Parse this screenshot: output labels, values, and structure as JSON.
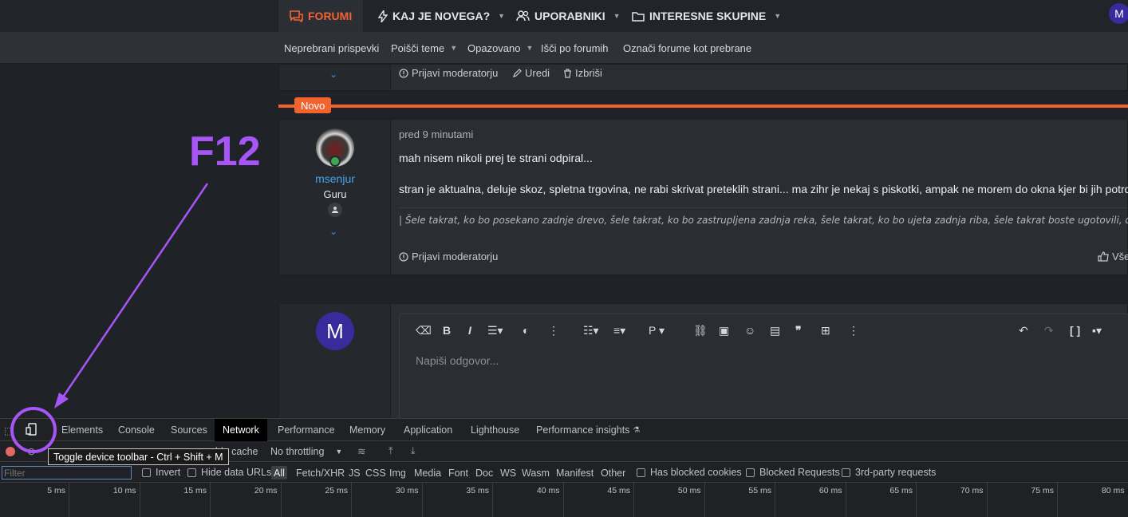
{
  "nav": {
    "items": [
      {
        "label": "FORUMI",
        "icon": "forum-icon"
      },
      {
        "label": "KAJ JE NOVEGA?",
        "icon": "bolt-icon"
      },
      {
        "label": "UPORABNIKI",
        "icon": "users-icon"
      },
      {
        "label": "INTERESNE SKUPINE",
        "icon": "folder-icon"
      }
    ],
    "avatar_letter": "M"
  },
  "subnav": {
    "items": [
      {
        "label": "Neprebrani prispevki"
      },
      {
        "label": "Poišči teme"
      },
      {
        "label": "Opazovano"
      },
      {
        "label": "Išči po forumih"
      },
      {
        "label": "Označi forume kot prebrane"
      }
    ]
  },
  "prev_post": {
    "actions": {
      "report": "Prijavi moderatorju",
      "edit": "Uredi",
      "delete": "Izbriši"
    }
  },
  "divider_label": "Novo",
  "post": {
    "username": "msenjur",
    "user_title": "Guru",
    "time": "pred 9 minutami",
    "line1": "mah nisem nikoli prej te strani odpiral...",
    "line2": "stran je aktualna, deluje skoz, spletna trgovina, ne rabi skrivat preteklih strani... ma zihr je nekaj s piskotki, ampak ne morem do okna kjer bi jih potrdi",
    "signature": "| Šele takrat, ko bo posekano zadnje drevo, šele takrat, ko bo zastrupljena zadnja reka, šele takrat, ko bo ujeta zadnja riba, šele takrat boste ugotovili, da se denarja j",
    "report": "Prijavi moderatorju",
    "like": "Vše"
  },
  "reply": {
    "avatar_letter": "M",
    "placeholder": "Napiši odgovor..."
  },
  "annotation": {
    "label": "F12"
  },
  "devtools": {
    "tabs": [
      "Elements",
      "Console",
      "Sources",
      "Network",
      "Performance",
      "Memory",
      "Application",
      "Lighthouse",
      "Performance insights"
    ],
    "active_tab": "Network",
    "tooltip": "Toggle device toolbar - Ctrl + Shift + M",
    "cache_label": "ble cache",
    "throttling": "No throttling",
    "filter_placeholder": "Filter",
    "invert": "Invert",
    "hide_data_urls": "Hide data URLs",
    "types": [
      "All",
      "Fetch/XHR",
      "JS",
      "CSS",
      "Img",
      "Media",
      "Font",
      "Doc",
      "WS",
      "Wasm",
      "Manifest",
      "Other"
    ],
    "has_blocked_cookies": "Has blocked cookies",
    "blocked_requests": "Blocked Requests",
    "third_party": "3rd-party requests",
    "timeline_ticks": [
      "5 ms",
      "10 ms",
      "15 ms",
      "20 ms",
      "25 ms",
      "30 ms",
      "35 ms",
      "40 ms",
      "45 ms",
      "50 ms",
      "55 ms",
      "60 ms",
      "65 ms",
      "70 ms",
      "75 ms",
      "80 ms"
    ]
  }
}
